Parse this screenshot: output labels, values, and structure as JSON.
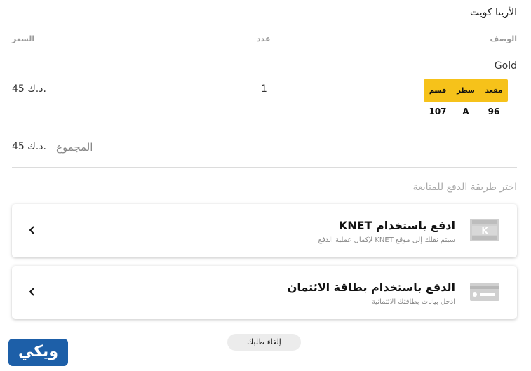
{
  "venue": "الأرينا كويت",
  "table": {
    "headers": {
      "description": "الوصف",
      "quantity": "عدد",
      "price": "السعر"
    },
    "item": {
      "class": "Gold",
      "seat_headers": [
        "مقعد",
        "سطر",
        "قسم"
      ],
      "seat_values": [
        "96",
        "A",
        "107"
      ],
      "quantity": "1",
      "price": "45 د.ك."
    }
  },
  "total": {
    "label": "المجموع",
    "value": "45 د.ك."
  },
  "choose_payment": "اختر طريقة الدفع للمتابعة",
  "payment_methods": [
    {
      "title": "ادفع باستخدام KNET",
      "subtitle": "سيتم نقلك إلى موقع KNET لإكمال عملية الدفع",
      "icon": "knet-logo-icon"
    },
    {
      "title": "الدفع باستخدام بطاقة الائتمان",
      "subtitle": "ادخل بيانات بطاقتك الائتمانية",
      "icon": "credit-card-icon"
    }
  ],
  "cancel_label": "إلغاء طلبك",
  "watermark": "ويكي",
  "colors": {
    "seat_header": "#f6c21a",
    "watermark_bg": "#1d5fa8"
  }
}
